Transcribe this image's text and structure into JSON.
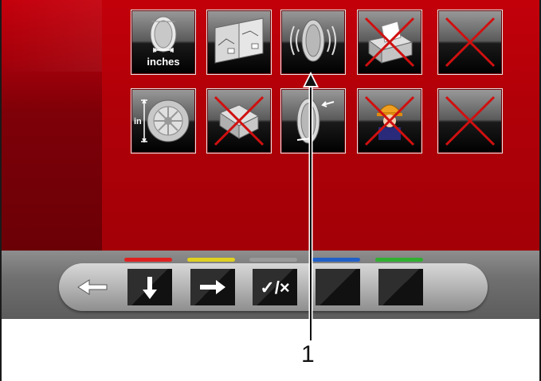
{
  "grid": {
    "row1": [
      {
        "name": "tire-width-inches",
        "icon": "tire-width-inches-icon",
        "label": "inches",
        "disabled": false
      },
      {
        "name": "calibration-charts",
        "icon": "calibration-charts-icon",
        "disabled": false
      },
      {
        "name": "tire-vibration",
        "icon": "tire-vibration-icon",
        "disabled": false
      },
      {
        "name": "printer",
        "icon": "printer-icon",
        "disabled": true
      },
      {
        "name": "empty-slot-1",
        "icon": "disabled-cross-icon",
        "disabled": true
      }
    ],
    "row2": [
      {
        "name": "rim-diameter-inches",
        "icon": "rim-diameter-inches-icon",
        "label": "in",
        "disabled": false
      },
      {
        "name": "weight-option",
        "icon": "weight-option-icon",
        "disabled": true
      },
      {
        "name": "tire-runout",
        "icon": "tire-runout-icon",
        "disabled": false
      },
      {
        "name": "operator-profile",
        "icon": "operator-helmet-icon",
        "disabled": true
      },
      {
        "name": "empty-slot-2",
        "icon": "disabled-cross-icon",
        "disabled": true
      }
    ]
  },
  "softkeys": [
    {
      "name": "back",
      "icon": "arrow-left-icon",
      "led_color": null
    },
    {
      "name": "down",
      "icon": "arrow-down-icon",
      "led_color": "#e02020"
    },
    {
      "name": "forward",
      "icon": "arrow-right-icon",
      "led_color": "#e0d020"
    },
    {
      "name": "toggle",
      "icon": "check-cross-icon",
      "label": "✓/×",
      "led_color": "#9a9a9a"
    },
    {
      "name": "blank-blue",
      "icon": "blank-key-icon",
      "led_color": "#2060c8"
    },
    {
      "name": "blank-green",
      "icon": "blank-key-icon",
      "led_color": "#30b030"
    }
  ],
  "callout": {
    "number": "1"
  },
  "colors": {
    "screen_red": "#b00008",
    "accent_dark": "#6a0006"
  }
}
